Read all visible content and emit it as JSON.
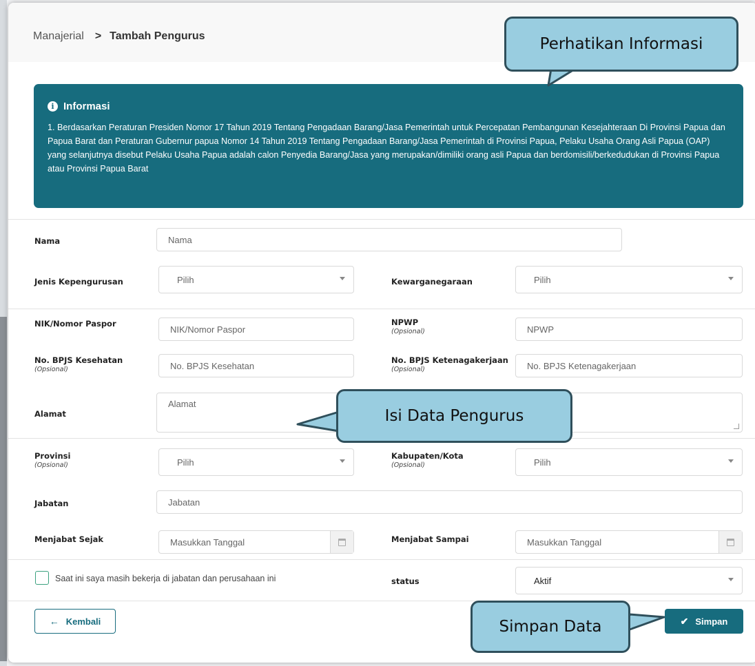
{
  "breadcrumb": {
    "parent": "Manajerial",
    "separator": ">",
    "current": "Tambah Pengurus"
  },
  "info": {
    "title": "Informasi",
    "text": "1. Berdasarkan Peraturan Presiden Nomor 17 Tahun 2019 Tentang Pengadaan Barang/Jasa Pemerintah untuk Percepatan Pembangunan Kesejahteraan Di Provinsi Papua dan Papua Barat dan Peraturan Gubernur papua Nomor 14 Tahun 2019 Tentang Pengadaan Barang/Jasa Pemerintah di Provinsi Papua, Pelaku Usaha Orang Asli Papua (OAP) yang selanjutnya disebut Pelaku Usaha Papua adalah calon Penyedia Barang/Jasa yang merupakan/dimiliki orang asli Papua dan berdomisili/berkedudukan di Provinsi Papua atau Provinsi Papua Barat"
  },
  "form": {
    "nama": {
      "label": "Nama",
      "placeholder": "Nama"
    },
    "jenis": {
      "label": "Jenis Kepengurusan",
      "value": "Pilih"
    },
    "kewarganegaraan": {
      "label": "Kewarganegaraan",
      "value": "Pilih"
    },
    "nik": {
      "label": "NIK/Nomor Paspor",
      "placeholder": "NIK/Nomor Paspor"
    },
    "npwp": {
      "label": "NPWP",
      "optional": "(Opsional)",
      "placeholder": "NPWP"
    },
    "bpjs_kes": {
      "label": "No. BPJS Kesehatan",
      "optional": "(Opsional)",
      "placeholder": "No. BPJS Kesehatan"
    },
    "bpjs_tk": {
      "label": "No. BPJS Ketenagakerjaan",
      "optional": "(Opsional)",
      "placeholder": "No. BPJS Ketenagakerjaan"
    },
    "alamat": {
      "label": "Alamat",
      "placeholder": "Alamat"
    },
    "provinsi": {
      "label": "Provinsi",
      "optional": "(Opsional)",
      "value": "Pilih"
    },
    "kabupaten": {
      "label": "Kabupaten/Kota",
      "optional": "(Opsional)",
      "value": "Pilih"
    },
    "jabatan": {
      "label": "Jabatan",
      "placeholder": "Jabatan"
    },
    "sejak": {
      "label": "Menjabat Sejak",
      "placeholder": "Masukkan Tanggal"
    },
    "sampai": {
      "label": "Menjabat Sampai",
      "placeholder": "Masukkan Tanggal"
    },
    "masih_bekerja": {
      "label": "Saat ini saya masih bekerja di jabatan dan perusahaan ini"
    },
    "status": {
      "label": "status",
      "value": "Aktif"
    }
  },
  "buttons": {
    "back": "Kembali",
    "save": "Simpan"
  },
  "callouts": {
    "info": "Perhatikan Informasi",
    "data": "Isi Data Pengurus",
    "save": "Simpan Data"
  },
  "colors": {
    "primary": "#176c7e",
    "callout_fill": "#99cde0",
    "callout_border": "#2f4f5b",
    "checkbox": "#3aa17e"
  }
}
